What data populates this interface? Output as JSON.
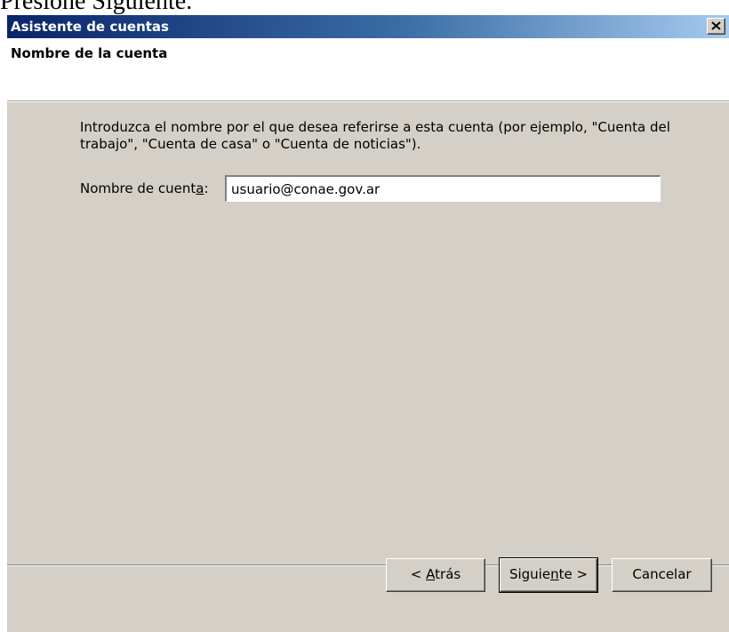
{
  "caption": "Presione Siguiente.",
  "window": {
    "title": "Asistente de cuentas",
    "close_icon": "close-icon"
  },
  "header": {
    "title": "Nombre de la cuenta"
  },
  "main": {
    "instruction": "Introduzca el nombre por el que desea referirse a esta cuenta (por ejemplo, \"Cuenta del trabajo\", \"Cuenta de casa\" o \"Cuenta de noticias\").",
    "account_name_label_pre": "Nombre de cuent",
    "account_name_label_access": "a",
    "account_name_label_post": ":",
    "account_name_value": "usuario@conae.gov.ar"
  },
  "buttons": {
    "back_pre": "< ",
    "back_access": "A",
    "back_post": "trás",
    "next_pre": "Siguie",
    "next_access": "n",
    "next_post": "te >",
    "cancel": "Cancelar"
  },
  "colors": {
    "titlebar_start": "#0a246a",
    "titlebar_end": "#a6caf0",
    "dialog_face": "#d4d0c8"
  }
}
